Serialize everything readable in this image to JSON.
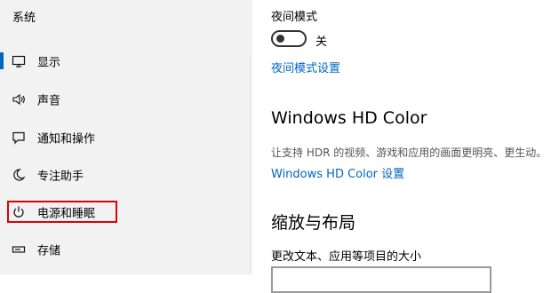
{
  "sidebar": {
    "title": "系统",
    "items": [
      {
        "label": "显示",
        "icon": "monitor-icon"
      },
      {
        "label": "声音",
        "icon": "speaker-icon"
      },
      {
        "label": "通知和操作",
        "icon": "notification-icon"
      },
      {
        "label": "专注助手",
        "icon": "moon-icon"
      },
      {
        "label": "电源和睡眠",
        "icon": "power-icon"
      },
      {
        "label": "存储",
        "icon": "storage-icon"
      }
    ],
    "selected": "显示",
    "highlighted": "电源和睡眠"
  },
  "main": {
    "night_light": {
      "label": "夜间模式",
      "toggle_state": "关",
      "settings_link": "夜间模式设置"
    },
    "hd_color": {
      "heading": "Windows HD Color",
      "description": "让支持 HDR 的视频、游戏和应用的画面更明亮、更生动。",
      "settings_link": "Windows HD Color 设置"
    },
    "scale_layout": {
      "heading": "缩放与布局",
      "label": "更改文本、应用等项目的大小"
    }
  },
  "colors": {
    "accent": "#0067c0",
    "highlight_border": "#e00000",
    "sidebar_bg": "#f2f2f2"
  }
}
